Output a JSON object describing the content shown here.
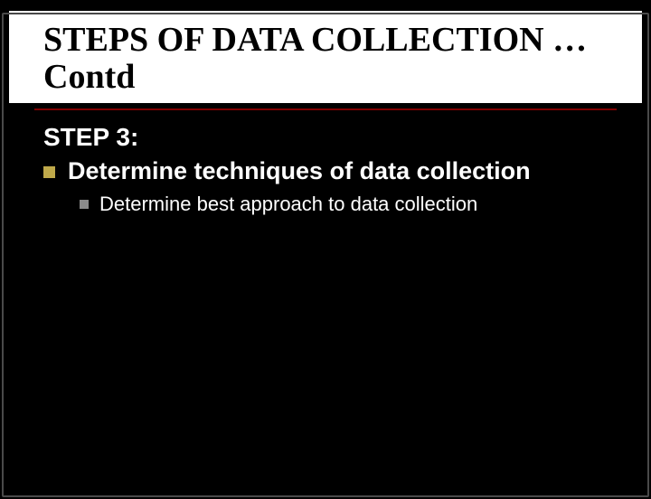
{
  "slide": {
    "title": "STEPS OF DATA COLLECTION …Contd",
    "step_label": "STEP 3:",
    "bullets": {
      "level1": "Determine techniques of data collection",
      "level2": "Determine best approach to data collection"
    }
  }
}
